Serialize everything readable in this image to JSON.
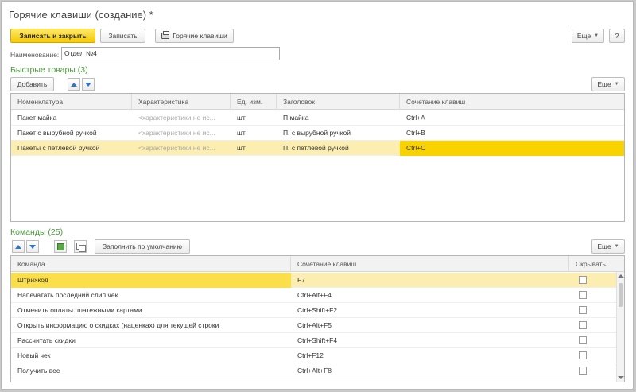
{
  "window": {
    "title": "Горячие клавиши (создание) *"
  },
  "toolbar": {
    "save_close": "Записать и закрыть",
    "save": "Записать",
    "hotkeys": "Горячие клавиши",
    "more": "Еще",
    "help": "?"
  },
  "name_field": {
    "label": "Наименование:",
    "value": "Отдел №4"
  },
  "quick_goods": {
    "title": "Быстрые товары (3)",
    "add": "Добавить",
    "more": "Еще",
    "columns": [
      "Номенклатура",
      "Характеристика",
      "Ед. изм.",
      "Заголовок",
      "Сочетание клавиш"
    ],
    "rows": [
      {
        "item": "Пакет майка",
        "char": "<характеристики не ис...",
        "unit": "шт",
        "caption": "П.майка",
        "keys": "Ctrl+A"
      },
      {
        "item": "Пакет с вырубной ручкой",
        "char": "<характеристики не ис...",
        "unit": "шт",
        "caption": "П. с вырубной ручкой",
        "keys": "Ctrl+B"
      },
      {
        "item": "Пакеты с петлевой ручкой",
        "char": "<характеристики не ис...",
        "unit": "шт",
        "caption": "П. с петлевой ручкой",
        "keys": "Ctrl+C"
      }
    ]
  },
  "commands": {
    "title": "Команды (25)",
    "fill_default": "Заполнить по умолчанию",
    "more": "Еще",
    "columns": [
      "Команда",
      "Сочетание клавиш",
      "Скрывать"
    ],
    "rows": [
      {
        "cmd": "Штрихкод",
        "keys": "F7"
      },
      {
        "cmd": "Напечатать последний слип чек",
        "keys": "Ctrl+Alt+F4"
      },
      {
        "cmd": "Отменить оплаты платежными картами",
        "keys": "Ctrl+Shift+F2"
      },
      {
        "cmd": "Открыть информацию о скидках (наценках) для текущей строки",
        "keys": "Ctrl+Alt+F5"
      },
      {
        "cmd": "Рассчитать скидки",
        "keys": "Ctrl+Shift+F4"
      },
      {
        "cmd": "Новый чек",
        "keys": "Ctrl+F12"
      },
      {
        "cmd": "Получить вес",
        "keys": "Ctrl+Alt+F8"
      }
    ]
  },
  "colors": {
    "accent_yellow": "#f9d300",
    "selection": "#fbeeb0",
    "section_green": "#4a9a3c",
    "arrow_blue": "#2f74c8"
  }
}
